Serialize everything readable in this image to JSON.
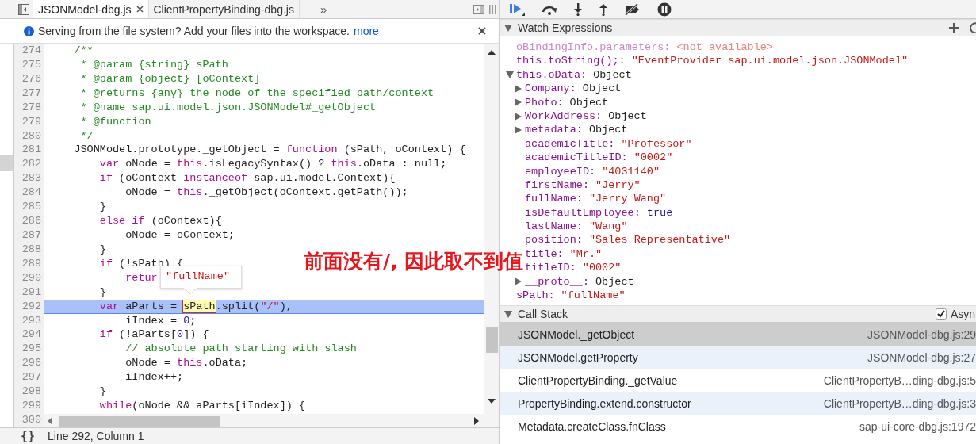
{
  "editor_tabs": [
    {
      "label": "JSONModel-dbg.js",
      "selected": true
    },
    {
      "label": "ClientPropertyBinding-dbg.js",
      "selected": false
    }
  ],
  "overflow_button": "»",
  "info_bar": {
    "message": "Serving from the file system? Add your files into the workspace.",
    "link": "more"
  },
  "editor": {
    "lines": [
      {
        "number": "274",
        "current": false,
        "tokens": [
          {
            "kind": "comment",
            "text": "    /**"
          }
        ]
      },
      {
        "number": "275",
        "current": false,
        "tokens": [
          {
            "kind": "comment",
            "text": "     * @param {string} sPath"
          }
        ]
      },
      {
        "number": "276",
        "current": false,
        "tokens": [
          {
            "kind": "comment",
            "text": "     * @param {object} [oContext]"
          }
        ]
      },
      {
        "number": "277",
        "current": false,
        "tokens": [
          {
            "kind": "comment",
            "text": "     * @returns {any} the node of the specified path/context"
          }
        ]
      },
      {
        "number": "278",
        "current": false,
        "tokens": [
          {
            "kind": "comment",
            "text": "     * @name sap.ui.model.json.JSONModel#_getObject"
          }
        ]
      },
      {
        "number": "279",
        "current": false,
        "tokens": [
          {
            "kind": "comment",
            "text": "     * @function"
          }
        ]
      },
      {
        "number": "280",
        "current": false,
        "tokens": [
          {
            "kind": "comment",
            "text": "     */"
          }
        ]
      },
      {
        "number": "281",
        "current": false,
        "tokens": [
          {
            "kind": "plain",
            "text": "    JSONModel.prototype._getObject = "
          },
          {
            "kind": "keyword",
            "text": "function"
          },
          {
            "kind": "plain",
            "text": " (sPath, oContext) {"
          }
        ]
      },
      {
        "number": "282",
        "current": false,
        "tokens": [
          {
            "kind": "keyword",
            "text": "        var"
          },
          {
            "kind": "plain",
            "text": " oNode = "
          },
          {
            "kind": "keyword",
            "text": "this"
          },
          {
            "kind": "plain",
            "text": ".isLegacySyntax() ? "
          },
          {
            "kind": "keyword",
            "text": "this"
          },
          {
            "kind": "plain",
            "text": ".oData : null;"
          }
        ]
      },
      {
        "number": "283",
        "current": false,
        "tokens": [
          {
            "kind": "keyword",
            "text": "        if"
          },
          {
            "kind": "plain",
            "text": " (oContext "
          },
          {
            "kind": "keyword",
            "text": "instanceof"
          },
          {
            "kind": "plain",
            "text": " sap.ui.model.Context){"
          }
        ]
      },
      {
        "number": "284",
        "current": false,
        "tokens": [
          {
            "kind": "plain",
            "text": "            oNode = "
          },
          {
            "kind": "keyword",
            "text": "this"
          },
          {
            "kind": "plain",
            "text": "._getObject(oContext.getPath());"
          }
        ]
      },
      {
        "number": "285",
        "current": false,
        "tokens": [
          {
            "kind": "plain",
            "text": "        }"
          }
        ]
      },
      {
        "number": "286",
        "current": false,
        "tokens": [
          {
            "kind": "keyword",
            "text": "        else if"
          },
          {
            "kind": "plain",
            "text": " (oContext){"
          }
        ]
      },
      {
        "number": "287",
        "current": false,
        "tokens": [
          {
            "kind": "plain",
            "text": "            oNode = oContext;"
          }
        ]
      },
      {
        "number": "288",
        "current": false,
        "tokens": [
          {
            "kind": "plain",
            "text": "        }"
          }
        ]
      },
      {
        "number": "289",
        "current": false,
        "tokens": [
          {
            "kind": "keyword",
            "text": "        if"
          },
          {
            "kind": "plain",
            "text": " (!sPath) {"
          }
        ]
      },
      {
        "number": "290",
        "current": false,
        "tokens": [
          {
            "kind": "keyword",
            "text": "            retur"
          }
        ]
      },
      {
        "number": "291",
        "current": false,
        "tokens": [
          {
            "kind": "plain",
            "text": "        }"
          }
        ]
      },
      {
        "number": "292",
        "current": true,
        "tokens": [
          {
            "kind": "keyword",
            "text": "        var"
          },
          {
            "kind": "plain",
            "text": " aParts = "
          },
          {
            "kind": "hovered",
            "text": "sPath"
          },
          {
            "kind": "plain",
            "text": ".split("
          },
          {
            "kind": "string",
            "text": "\"/\""
          },
          {
            "kind": "plain",
            "text": "),"
          }
        ]
      },
      {
        "number": "293",
        "current": false,
        "tokens": [
          {
            "kind": "plain",
            "text": "            iIndex = "
          },
          {
            "kind": "number",
            "text": "0"
          },
          {
            "kind": "plain",
            "text": ";"
          }
        ]
      },
      {
        "number": "294",
        "current": false,
        "tokens": [
          {
            "kind": "keyword",
            "text": "        if"
          },
          {
            "kind": "plain",
            "text": " (!aParts["
          },
          {
            "kind": "number",
            "text": "0"
          },
          {
            "kind": "plain",
            "text": "]) {"
          }
        ]
      },
      {
        "number": "295",
        "current": false,
        "tokens": [
          {
            "kind": "comment",
            "text": "            // absolute path starting with slash"
          }
        ]
      },
      {
        "number": "296",
        "current": false,
        "tokens": [
          {
            "kind": "plain",
            "text": "            oNode = "
          },
          {
            "kind": "keyword",
            "text": "this"
          },
          {
            "kind": "plain",
            "text": ".oData;"
          }
        ]
      },
      {
        "number": "297",
        "current": false,
        "tokens": [
          {
            "kind": "plain",
            "text": "            iIndex++;"
          }
        ]
      },
      {
        "number": "298",
        "current": false,
        "tokens": [
          {
            "kind": "plain",
            "text": "        }"
          }
        ]
      },
      {
        "number": "299",
        "current": false,
        "tokens": [
          {
            "kind": "keyword",
            "text": "        while"
          },
          {
            "kind": "plain",
            "text": "(oNode && aParts[iIndex]) {"
          }
        ]
      },
      {
        "number": "300"
      }
    ],
    "tooltip": "\"fullName\"",
    "annotation": "前面没有/, 因此取不到值"
  },
  "status_bar": {
    "format_button": "{}",
    "position": "Line 292, Column 1"
  },
  "watch": {
    "title": "Watch Expressions",
    "items": [
      {
        "kind": "unavailable",
        "name": "oBindingInfo.parameters:",
        "value": "<not available>"
      },
      {
        "kind": "string",
        "name": "this.toString();:",
        "value": "\"EventProvider sap.ui.model.json.JSONModel\""
      },
      {
        "kind": "object",
        "name": "this.oData:",
        "value": "Object",
        "expanded": true,
        "children": [
          {
            "kind": "object",
            "name": "Company:",
            "value": "Object",
            "expanded": false
          },
          {
            "kind": "object",
            "name": "Photo:",
            "value": "Object",
            "expanded": false
          },
          {
            "kind": "object",
            "name": "WorkAddress:",
            "value": "Object",
            "expanded": false
          },
          {
            "kind": "object",
            "name": "metadata:",
            "value": "Object",
            "expanded": false
          },
          {
            "kind": "string",
            "name": "academicTitle:",
            "value": "\"Professor\""
          },
          {
            "kind": "string",
            "name": "academicTitleID:",
            "value": "\"0002\""
          },
          {
            "kind": "string",
            "name": "employeeID:",
            "value": "\"4031140\""
          },
          {
            "kind": "string",
            "name": "firstName:",
            "value": "\"Jerry\""
          },
          {
            "kind": "string",
            "name": "fullName:",
            "value": "\"Jerry Wang\""
          },
          {
            "kind": "boolean",
            "name": "isDefaultEmployee:",
            "value": "true"
          },
          {
            "kind": "string",
            "name": "lastName:",
            "value": "\"Wang\""
          },
          {
            "kind": "string",
            "name": "position:",
            "value": "\"Sales Representative\""
          },
          {
            "kind": "string",
            "name": "title:",
            "value": "\"Mr.\""
          },
          {
            "kind": "string",
            "name": "titleID:",
            "value": "\"0002\""
          },
          {
            "kind": "object",
            "name": "__proto__:",
            "value": "Object",
            "expanded": false
          }
        ]
      },
      {
        "kind": "string",
        "name": "sPath:",
        "value": "\"fullName\""
      }
    ]
  },
  "call_stack": {
    "title": "Call Stack",
    "async_checked": true,
    "async_label": "Asyn",
    "frames": [
      {
        "function": "JSONModel._getObject",
        "location": "JSONModel-dbg.js:29",
        "selected": true
      },
      {
        "function": "JSONModel.getProperty",
        "location": "JSONModel-dbg.js:27",
        "selected": false
      },
      {
        "function": "ClientPropertyBinding._getValue",
        "location": "ClientPropertyB…ding-dbg.js:5",
        "selected": false
      },
      {
        "function": "PropertyBinding.extend.constructor",
        "location": "ClientPropertyB…ding-dbg.js:3",
        "selected": false
      },
      {
        "function": "Metadata.createClass.fnClass",
        "location": "sap-ui-core-dbg.js:1972",
        "selected": false
      }
    ]
  }
}
